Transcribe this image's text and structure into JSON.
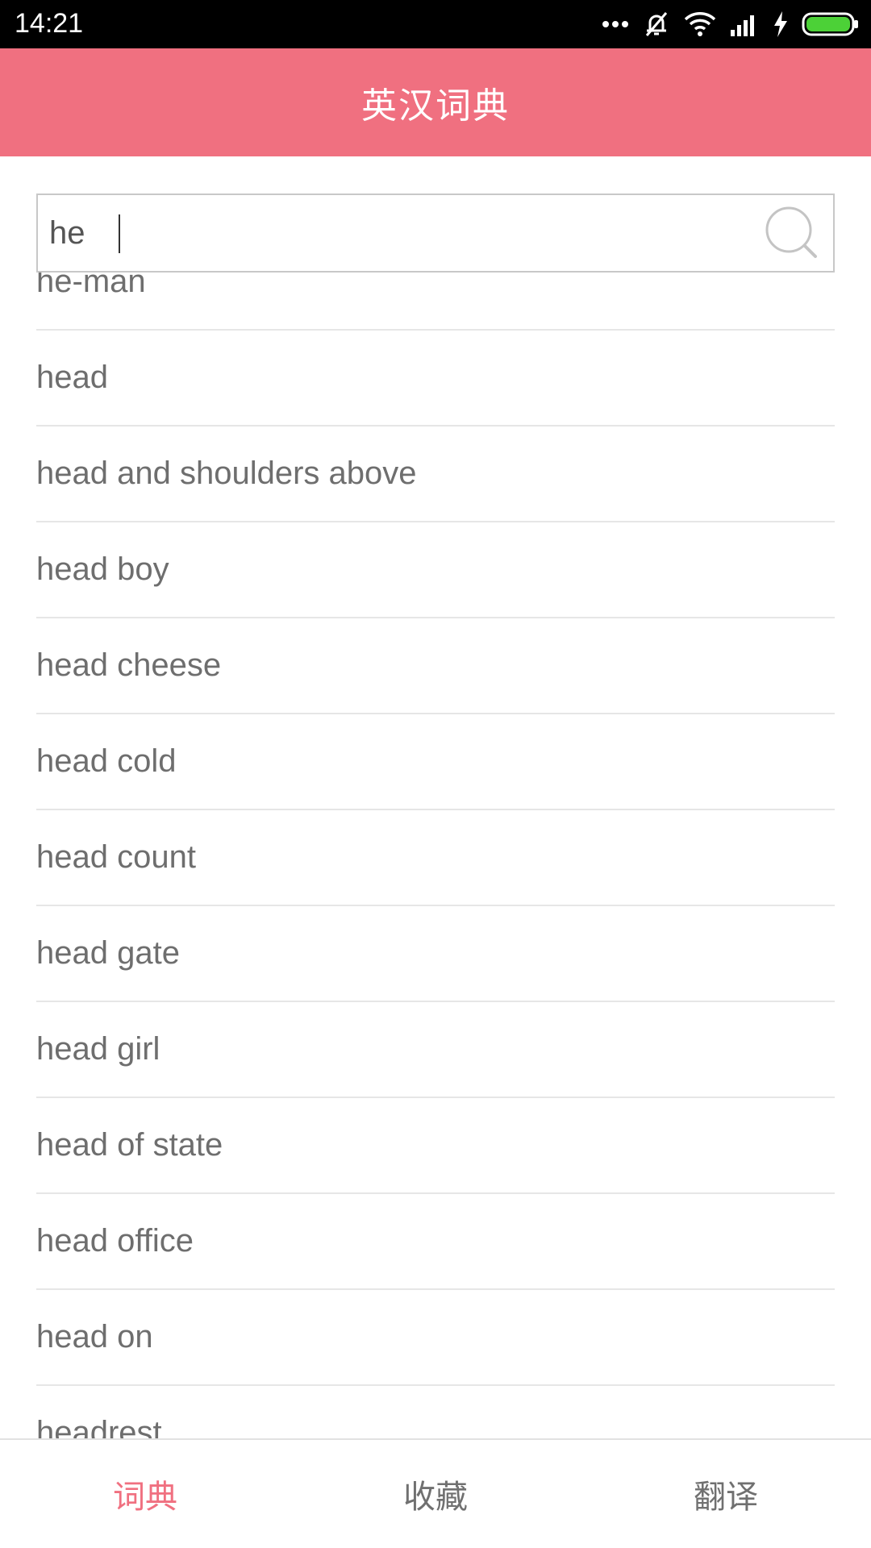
{
  "status_bar": {
    "time": "14:21",
    "icons": [
      "more-dots-icon",
      "mute-bell-icon",
      "wifi-icon",
      "signal-icon",
      "charging-bolt-icon",
      "battery-icon"
    ]
  },
  "header": {
    "title": "英汉词典"
  },
  "search": {
    "value": "he",
    "icon": "search-icon"
  },
  "suggestions": [
    "he-man",
    "head",
    "head and shoulders above",
    "head boy",
    "head cheese",
    "head cold",
    "head count",
    "head gate",
    "head girl",
    "head of state",
    "head office",
    "head on",
    "headrest"
  ],
  "tabs": [
    {
      "label": "词典",
      "active": true
    },
    {
      "label": "收藏",
      "active": false
    },
    {
      "label": "翻译",
      "active": false
    }
  ],
  "colors": {
    "accent": "#f07080",
    "statusbar": "#000000",
    "text": "#6e6e6e",
    "battery": "#4cd137"
  }
}
